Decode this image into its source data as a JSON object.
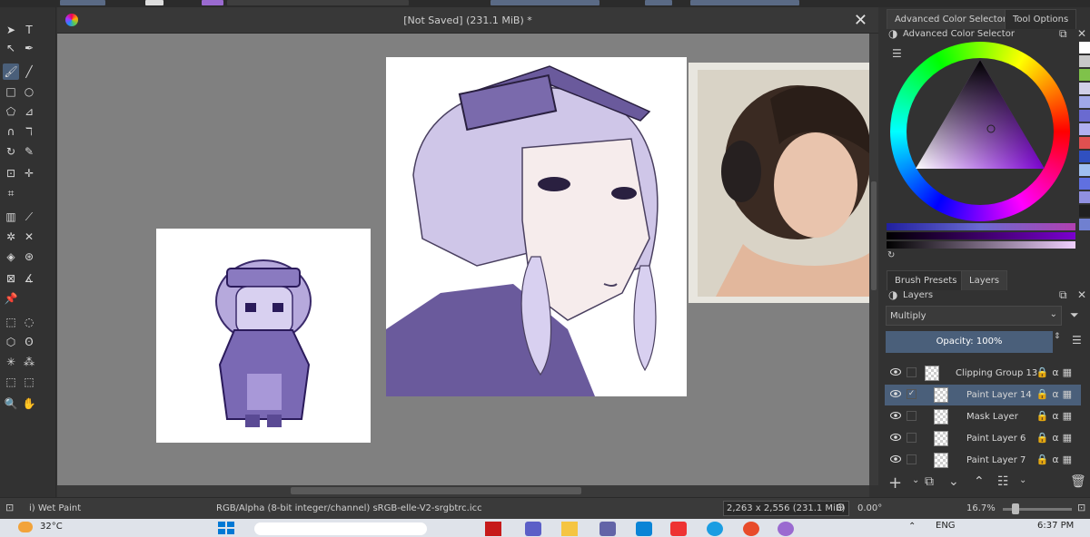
{
  "document": {
    "title": "[Not Saved]  (231.1 MiB) *",
    "close_symbol": "✕"
  },
  "dock": {
    "top_tabs": [
      "Advanced Color Selector",
      "Tool Options"
    ],
    "color_panel_title": "Advanced Color Selector",
    "mid_tabs": [
      "Brush Presets",
      "Layers"
    ],
    "layers_panel_title": "Layers",
    "blend_mode": "Multiply",
    "opacity_label": "Opacity:  100%",
    "layers": [
      {
        "name": "Clipping Group 13",
        "selected": false,
        "checked": false
      },
      {
        "name": "Paint Layer 14",
        "selected": true,
        "checked": true
      },
      {
        "name": "Mask Layer",
        "selected": false,
        "checked": false
      },
      {
        "name": "Paint Layer 6",
        "selected": false,
        "checked": false
      },
      {
        "name": "Paint Layer 7",
        "selected": false,
        "checked": false
      }
    ],
    "swatches": [
      "#ffffff",
      "#c8c8c8",
      "#7fc24a",
      "#d0d0e8",
      "#a0a8e8",
      "#6a6ad0",
      "#b0b0f0",
      "#e05050",
      "#3050c0",
      "#a0c0f0",
      "#6070e0",
      "#9090e0",
      "#202020",
      "#7080d0"
    ]
  },
  "status": {
    "brush": "i) Wet Paint",
    "color_model": "RGB/Alpha (8-bit integer/channel)  sRGB-elle-V2-srgbtrc.icc",
    "dimensions": "2,263 x 2,556 (231.1 MiB)",
    "rotation": "0.00°",
    "zoom": "16.7%"
  },
  "taskbar": {
    "temperature": "32°C",
    "language": "ENG",
    "time": "6:37 PM"
  },
  "colors": {
    "accent": "#4a5f7a",
    "canvas_bg": "#808080",
    "art_purple": "#6a5a9c",
    "hair_lavender": "#cfc6e8"
  }
}
